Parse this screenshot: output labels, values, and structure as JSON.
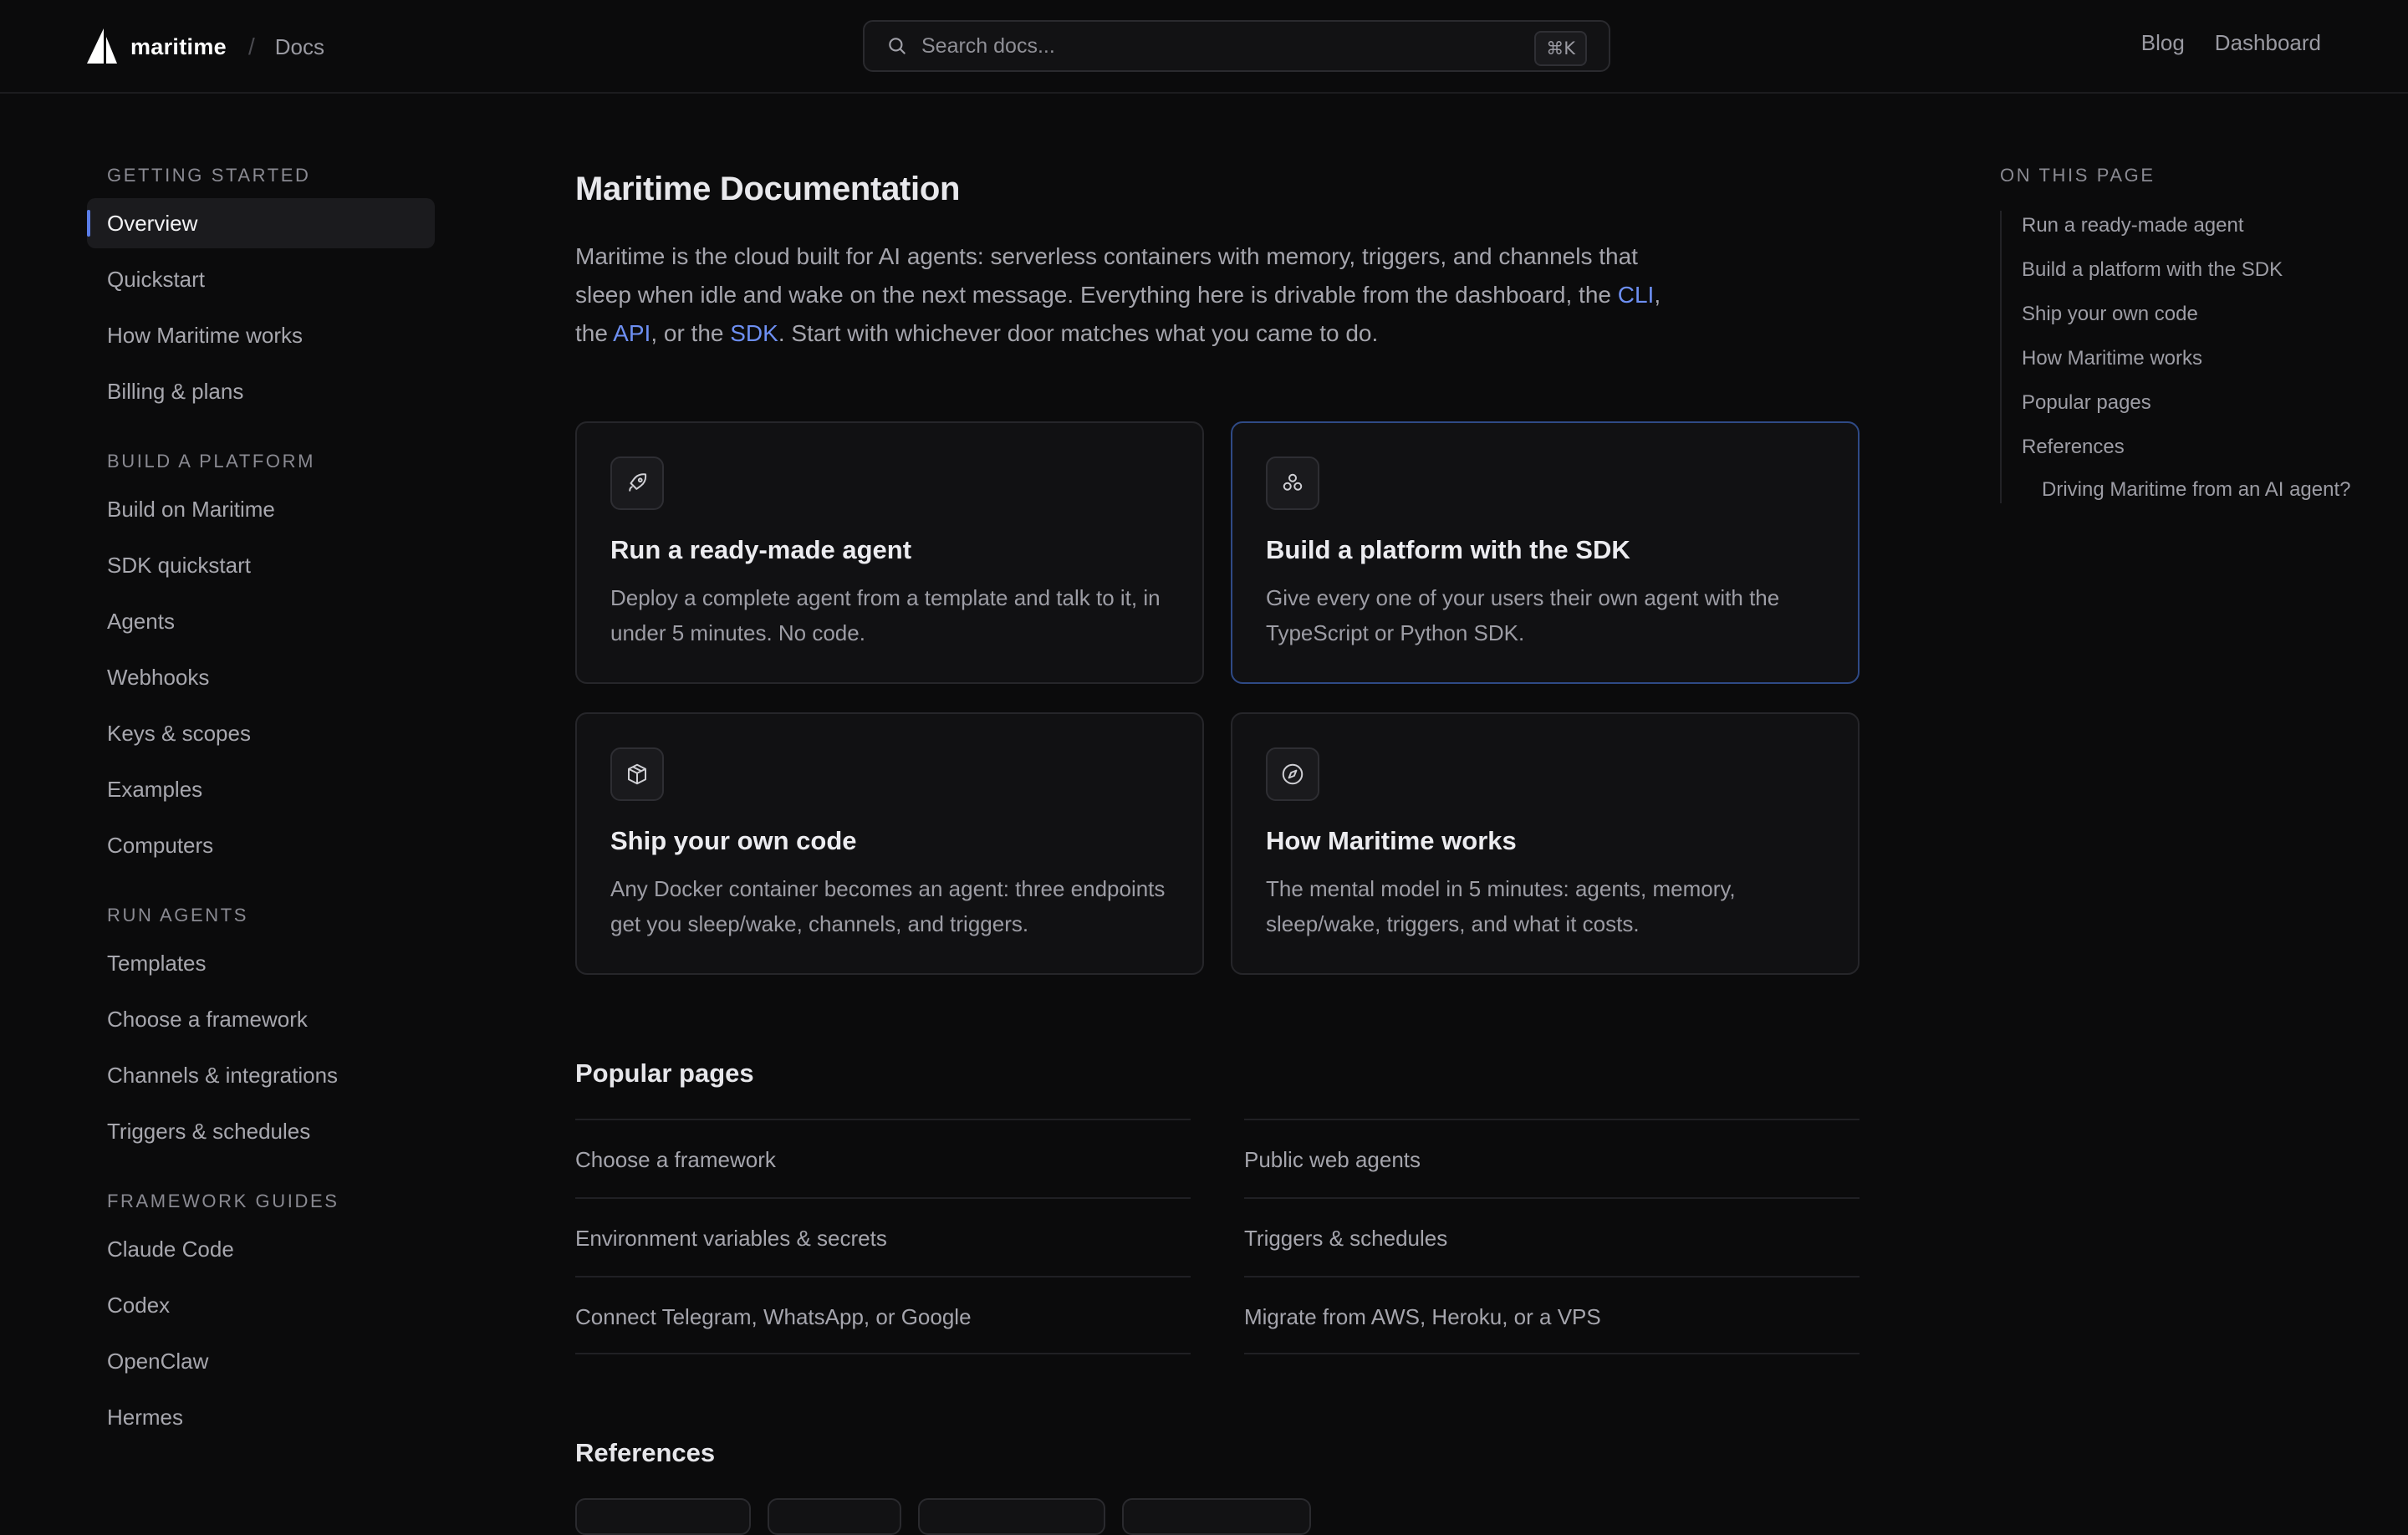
{
  "header": {
    "brand": "maritime",
    "separator": "/",
    "section": "Docs",
    "search_placeholder": "Search docs...",
    "search_shortcut": "⌘K",
    "links": [
      "Blog",
      "Dashboard"
    ]
  },
  "sidebar": {
    "sections": [
      {
        "heading": "GETTING STARTED",
        "items": [
          "Overview",
          "Quickstart",
          "How Maritime works",
          "Billing & plans"
        ]
      },
      {
        "heading": "BUILD A PLATFORM",
        "items": [
          "Build on Maritime",
          "SDK quickstart",
          "Agents",
          "Webhooks",
          "Keys & scopes",
          "Examples",
          "Computers"
        ]
      },
      {
        "heading": "RUN AGENTS",
        "items": [
          "Templates",
          "Choose a framework",
          "Channels & integrations",
          "Triggers & schedules"
        ]
      },
      {
        "heading": "FRAMEWORK GUIDES",
        "items": [
          "Claude Code",
          "Codex",
          "OpenClaw",
          "Hermes"
        ]
      }
    ],
    "active_item": "Overview"
  },
  "main": {
    "title": "Maritime Documentation",
    "intro": {
      "p1": "Maritime is the cloud built for AI agents: serverless containers with memory, triggers, and channels that sleep when idle and wake on the next message. Everything here is drivable from the dashboard, the ",
      "cli": "CLI",
      "p2": ", the ",
      "api": "API",
      "p3": ", or the ",
      "sdk": "SDK",
      "p4": ". Start with whichever door matches what you came to do."
    },
    "cards": [
      {
        "icon": "rocket-icon",
        "title": "Run a ready-made agent",
        "desc": "Deploy a complete agent from a template and talk to it, in under 5 minutes. No code."
      },
      {
        "icon": "components-icon",
        "title": "Build a platform with the SDK",
        "desc": "Give every one of your users their own agent with the TypeScript or Python SDK."
      },
      {
        "icon": "package-icon",
        "title": "Ship your own code",
        "desc": "Any Docker container becomes an agent: three endpoints get you sleep/wake, channels, and triggers."
      },
      {
        "icon": "compass-icon",
        "title": "How Maritime works",
        "desc": "The mental model in 5 minutes: agents, memory, sleep/wake, triggers, and what it costs."
      }
    ],
    "popular": {
      "heading": "Popular pages",
      "items": [
        "Choose a framework",
        "Public web agents",
        "Environment variables & secrets",
        "Triggers & schedules",
        "Connect Telegram, WhatsApp, or Google",
        "Migrate from AWS, Heroku, or a VPS"
      ]
    },
    "references": {
      "heading": "References"
    }
  },
  "toc": {
    "heading": "ON THIS PAGE",
    "items": [
      "Run a ready-made agent",
      "Build a platform with the SDK",
      "Ship your own code",
      "How Maritime works",
      "Popular pages",
      "References"
    ],
    "sub_item": "Driving Maritime from an AI agent?"
  },
  "colors": {
    "accent": "#5a7de8",
    "link": "#6d8ff2",
    "background": "#0b0b0c"
  }
}
